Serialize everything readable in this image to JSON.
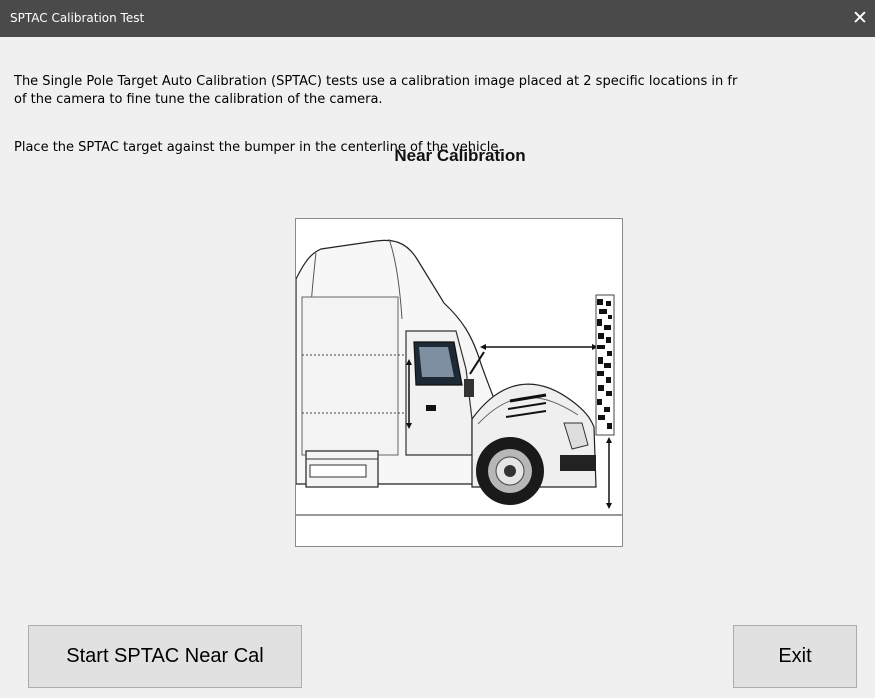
{
  "window": {
    "title": "SPTAC Calibration Test",
    "close_symbol": "✕"
  },
  "content": {
    "intro_line1": "The Single Pole Target Auto Calibration (SPTAC) tests use a calibration image placed at 2 specific locations in fr",
    "intro_line2": "of the camera to fine tune the calibration of the camera.",
    "placement": "Place the SPTAC target against the bumper in the centerline of the vehicle.",
    "heading": "Near Calibration",
    "image_icon": "truck-front-with-calibration-target"
  },
  "buttons": {
    "start": "Start SPTAC Near Cal",
    "exit": "Exit"
  }
}
